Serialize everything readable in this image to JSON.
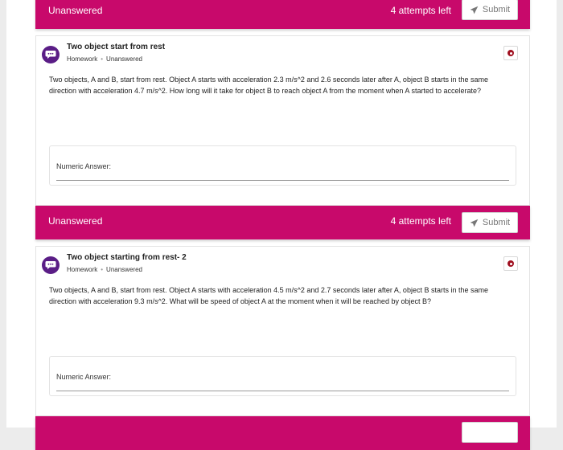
{
  "bars": [
    {
      "status": "Unanswered",
      "attempts": "4 attempts left",
      "submit_label": "Submit"
    },
    {
      "status": "Unanswered",
      "attempts": "4 attempts left",
      "submit_label": "Submit"
    },
    {
      "status": "",
      "attempts": "",
      "submit_label": ""
    }
  ],
  "questions": [
    {
      "title": "Two object start from rest",
      "type": "Homework",
      "status": "Unanswered",
      "body": "Two objects, A and B, start from rest. Object A starts with acceleration 2.3 m/s^2 and 2.6 seconds later after A, object B starts in the same direction with acceleration 4.7 m/s^2. How long will it take for object B to reach object A from the moment when A started to accelerate?",
      "answer_label": "Numeric Answer:"
    },
    {
      "title": "Two object starting from rest- 2",
      "type": "Homework",
      "status": "Unanswered",
      "body": "Two objects, A and B, start from rest. Object A starts with acceleration 4.5 m/s^2 and 2.7 seconds later after A, object B starts in the same direction with acceleration 9.3 m/s^2. What will be speed of object A at the moment when it will be reached by object B?",
      "answer_label": "Numeric Answer:"
    }
  ],
  "icons": {
    "avatar": "chat-bubble-icon",
    "submit": "paper-plane-icon",
    "badge": "record-dot-icon"
  },
  "colors": {
    "bar": "#c8096b",
    "avatar": "#5a1d86",
    "badge": "#a01020"
  }
}
